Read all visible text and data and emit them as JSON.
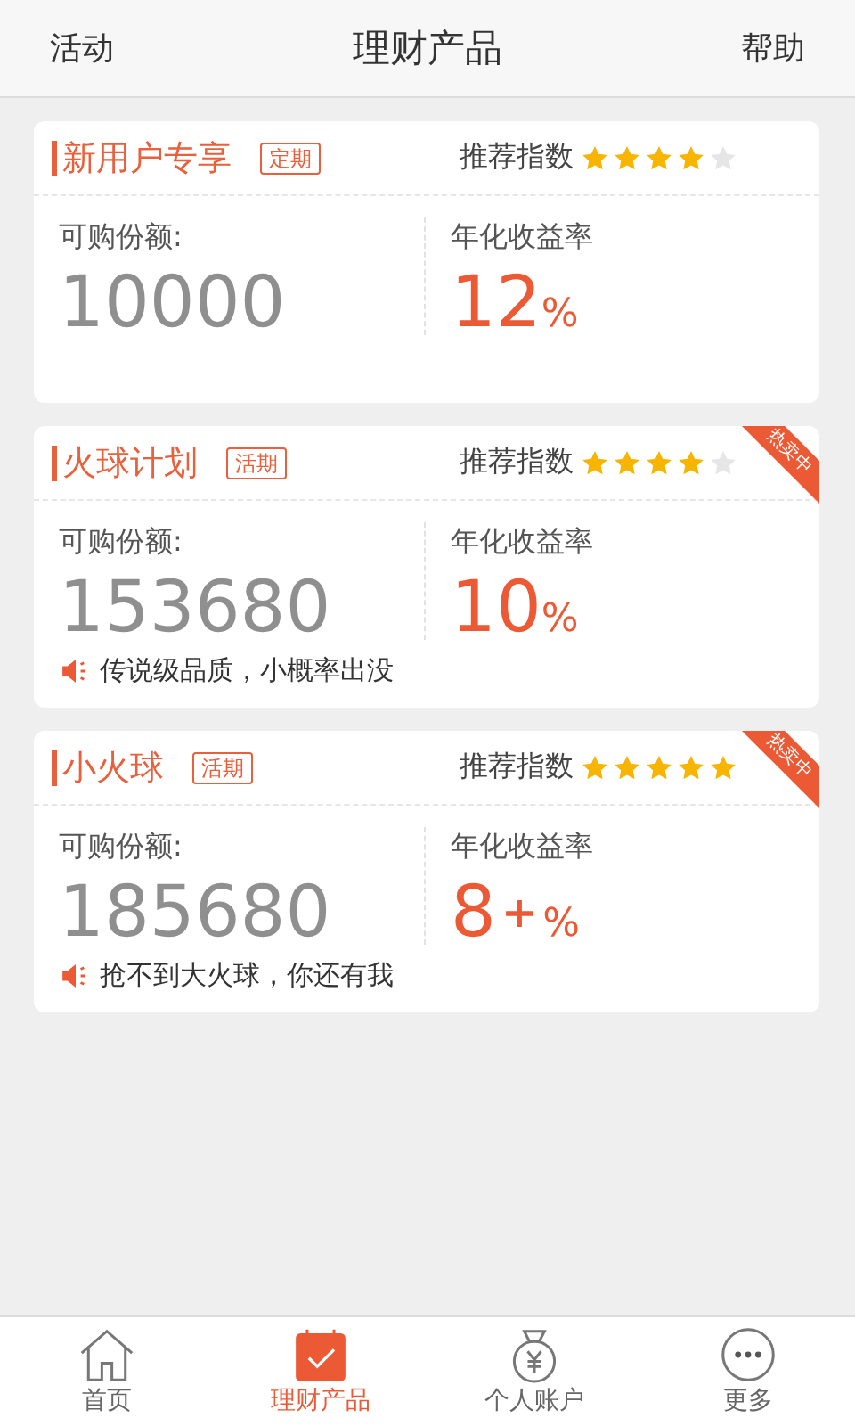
{
  "header": {
    "left": "活动",
    "title": "理财产品",
    "right": "帮助"
  },
  "products": [
    {
      "name": "新用户专享",
      "tag": "定期",
      "rating_label": "推荐指数",
      "stars": 4,
      "hot": false,
      "amount_label": "可购份额:",
      "amount": "10000",
      "rate_label": "年化收益率",
      "rate": "12",
      "unit": "%"
    },
    {
      "name": "火球计划",
      "tag": "活期",
      "rating_label": "推荐指数",
      "stars": 4,
      "hot": true,
      "ribbon": "热卖中",
      "amount_label": "可购份额:",
      "amount": "153680",
      "rate_label": "年化收益率",
      "rate": "10",
      "unit": "%",
      "note": "传说级品质，小概率出没"
    },
    {
      "name": "小火球",
      "tag": "活期",
      "rating_label": "推荐指数",
      "stars": 5,
      "hot": true,
      "ribbon": "热卖中",
      "amount_label": "可购份额:",
      "amount": "185680",
      "rate_label": "年化收益率",
      "rate": "8",
      "rate_extra": "+",
      "unit": "%",
      "note": "抢不到大火球，你还有我"
    }
  ],
  "tabbar": [
    {
      "kind": "home",
      "label": "首页",
      "selected": false
    },
    {
      "kind": "calendar",
      "label": "理财产品",
      "selected": true
    },
    {
      "kind": "moneybag",
      "label": "个人账户",
      "selected": false
    },
    {
      "kind": "more",
      "label": "更多",
      "selected": false
    }
  ]
}
